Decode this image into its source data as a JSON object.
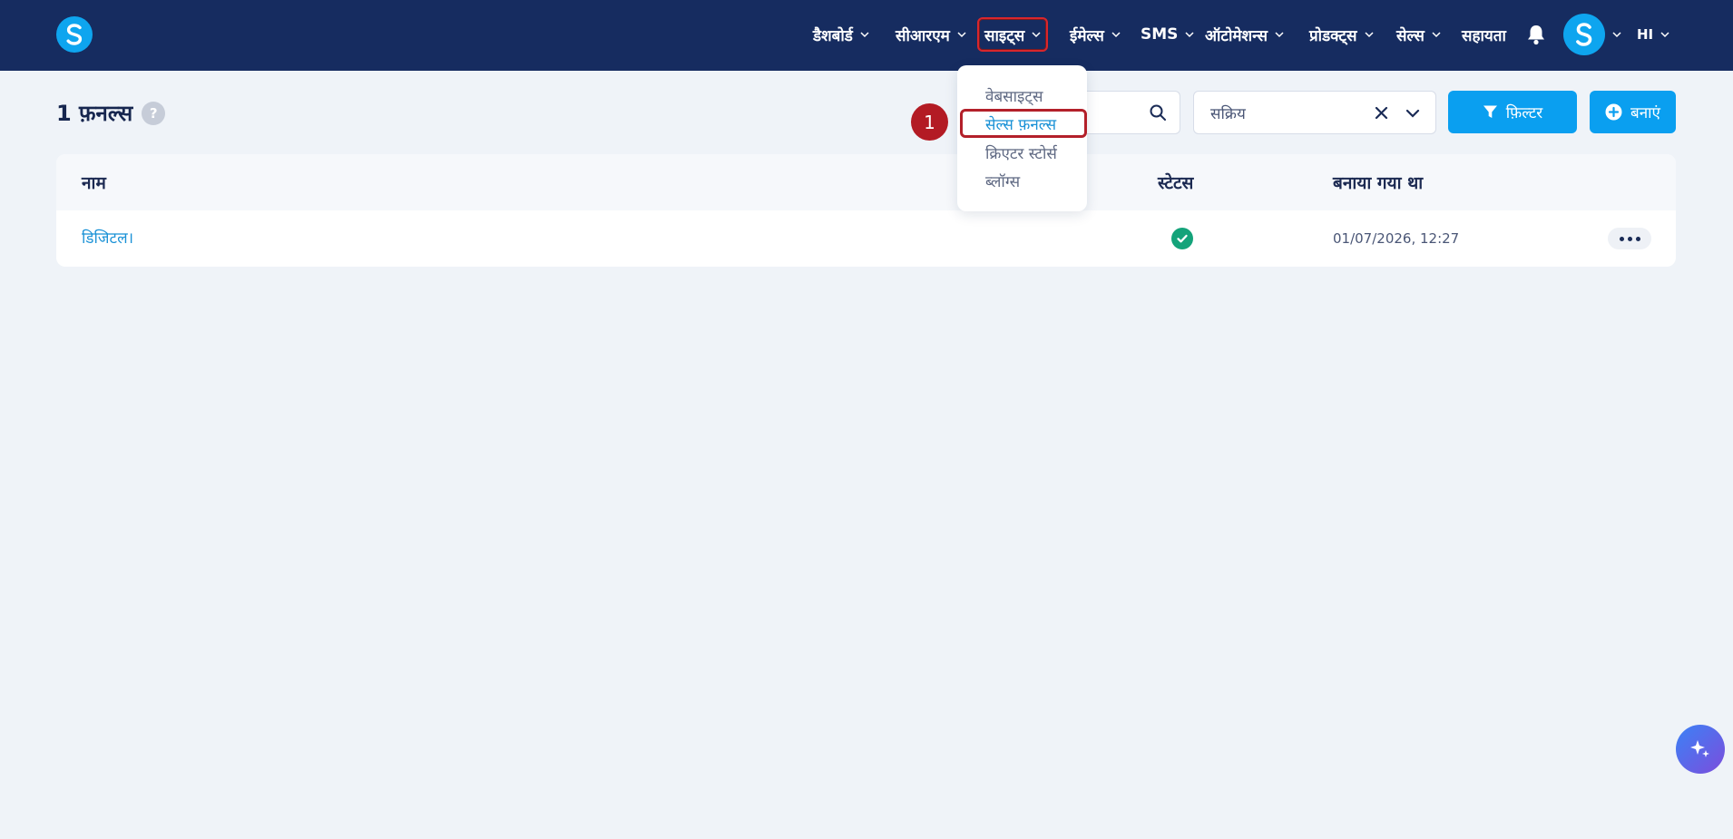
{
  "colors": {
    "navbar": "#162c60",
    "accent": "#0a9ff0",
    "link": "#1991d6",
    "success": "#14a37a",
    "highlight": "#b3202a",
    "background": "#eff3f8"
  },
  "navbar": {
    "logo_icon": "s-logo-icon",
    "items": [
      {
        "label": "डैशबोर्ड"
      },
      {
        "label": "सीआरएम"
      },
      {
        "label": "साइट्स"
      },
      {
        "label": "ईमेल्स"
      },
      {
        "label": "SMS"
      },
      {
        "label": "ऑटोमेशन्स"
      },
      {
        "label": "प्रोडक्ट्स"
      },
      {
        "label": "सेल्स"
      },
      {
        "label": "सहायता"
      }
    ],
    "active_item": "साइट्स",
    "bell_icon": "bell-icon",
    "avatar_icon": "s-avatar-icon",
    "language": "HI"
  },
  "header": {
    "title": "1 फ़नल्स",
    "help": "?"
  },
  "toolbar": {
    "status_value": "सक्रिय",
    "filter_label": "फ़िल्टर",
    "create_label": "बनाएं"
  },
  "sites_menu": {
    "items": [
      {
        "label": "वेबसाइट्स"
      },
      {
        "label": "सेल्स फ़नल्स"
      },
      {
        "label": "क्रिएटर स्टोर्स"
      },
      {
        "label": "ब्लॉग्स"
      }
    ],
    "selected": "सेल्स फ़नल्स"
  },
  "annotation": {
    "step": "1"
  },
  "table": {
    "columns": [
      "नाम",
      "स्टेटस",
      "बनाया गया था"
    ],
    "rows": [
      {
        "name": "डिजिटल।",
        "status": "active",
        "created": "01/07/2026, 12:27"
      }
    ]
  }
}
